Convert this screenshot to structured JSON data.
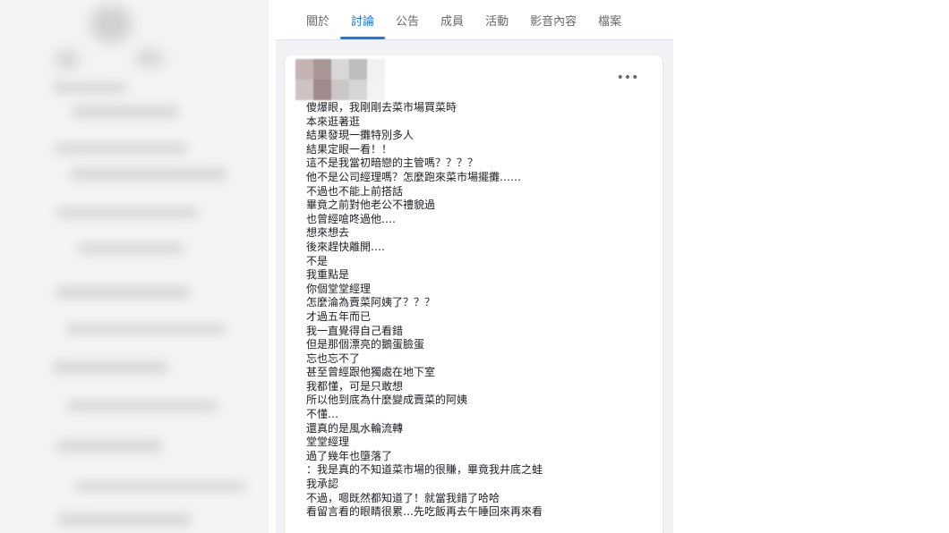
{
  "nav": {
    "tabs": [
      {
        "label": "關於",
        "active": false
      },
      {
        "label": "討論",
        "active": true
      },
      {
        "label": "公告",
        "active": false
      },
      {
        "label": "成員",
        "active": false
      },
      {
        "label": "活動",
        "active": false
      },
      {
        "label": "影音內容",
        "active": false
      },
      {
        "label": "檔案",
        "active": false
      }
    ]
  },
  "post": {
    "more_icon": "more-horizontal-icon",
    "lines": [
      "傻爆眼，我剛剛去菜市場買菜時",
      "本來逛著逛",
      "結果發現一攤特別多人",
      "結果定眼一看！！",
      "這不是我當初暗戀的主管嗎？？？？",
      "他不是公司經理嗎？怎麼跑來菜市場擺攤……",
      "不過也不能上前搭話",
      "畢竟之前對他老公不禮貌過",
      "也曾經嗆咚過他….",
      "想來想去",
      "後來趕快離開….",
      "不是",
      "我重點是",
      "你個堂堂經理",
      "怎麼淪為賣菜阿姨了？？？",
      "才過五年而已",
      "我一直覺得自己看錯",
      "但是那個漂亮的鵝蛋臉蛋",
      "忘也忘不了",
      "甚至曾經跟他獨處在地下室",
      "我都懂，可是只敢想",
      "所以他到底為什麼變成賣菜的阿姨",
      "不懂…",
      "還真的是風水輪流轉",
      "堂堂經理",
      "過了幾年也墮落了",
      "：我是真的不知道菜市場的很賺，畢竟我井底之蛙",
      "我承認",
      "不過，嗯既然都知道了！就當我錯了哈哈",
      "看留言看的眼睛很累…先吃飯再去午睡回來再來看"
    ]
  },
  "colors": {
    "accent": "#1877f2",
    "background": "#f0f2f5",
    "card": "#ffffff",
    "text": "#1c1e21",
    "muted": "#65676b"
  }
}
